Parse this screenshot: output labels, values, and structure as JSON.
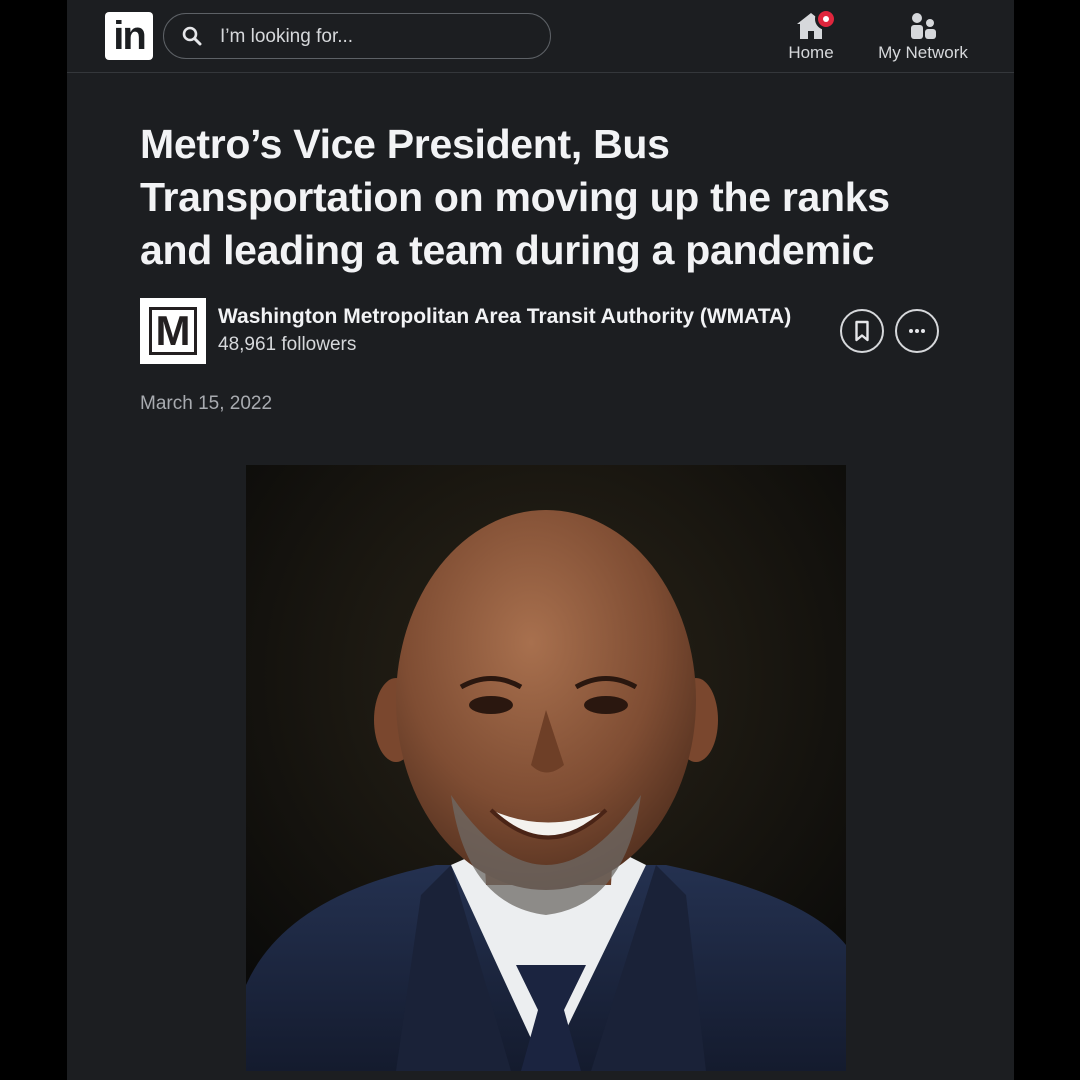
{
  "header": {
    "logo_text": "in",
    "search_placeholder": "I’m looking for...",
    "nav": [
      {
        "label": "Home",
        "icon": "home-icon",
        "has_notification": true
      },
      {
        "label": "My Network",
        "icon": "people-icon"
      }
    ]
  },
  "article": {
    "title": "Metro’s Vice President, Bus Transportation on moving up the ranks and leading a team during a pandemic",
    "author": {
      "logo_letter": "M",
      "name": "Washington Metropolitan Area Transit Authority (WMATA)",
      "followers": "48,961 followers"
    },
    "date": "March 15, 2022",
    "actions": [
      {
        "icon": "bookmark-icon"
      },
      {
        "icon": "more-icon"
      }
    ]
  },
  "colors": {
    "background": "#1c1e21",
    "text": "#f2f3f5",
    "notification": "#e0263d"
  }
}
